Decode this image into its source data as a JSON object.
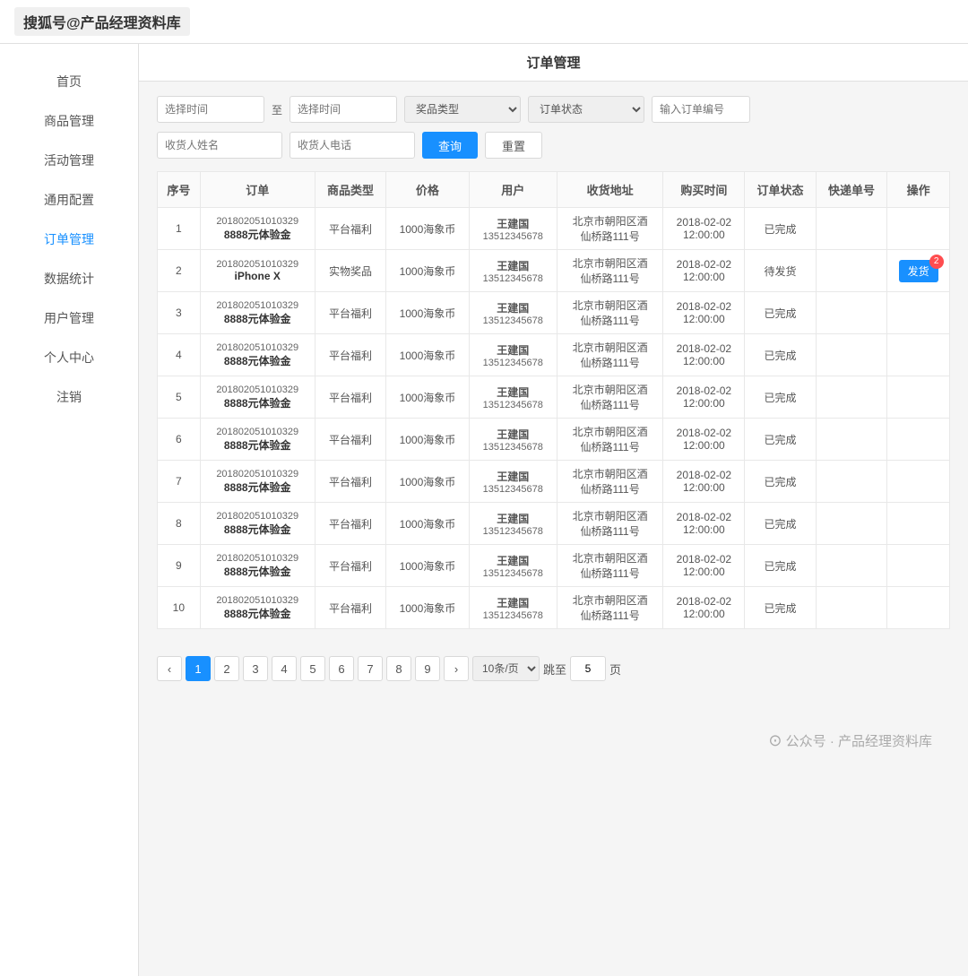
{
  "header": {
    "logo": "搜狐号@产品经理资料库"
  },
  "page_title": "订单管理",
  "sidebar": {
    "items": [
      {
        "label": "首页",
        "active": false
      },
      {
        "label": "商品管理",
        "active": false
      },
      {
        "label": "活动管理",
        "active": false
      },
      {
        "label": "通用配置",
        "active": false
      },
      {
        "label": "订单管理",
        "active": true
      },
      {
        "label": "数据统计",
        "active": false
      },
      {
        "label": "用户管理",
        "active": false
      },
      {
        "label": "个人中心",
        "active": false
      },
      {
        "label": "注销",
        "active": false
      }
    ]
  },
  "filters": {
    "date_from_placeholder": "选择时间",
    "date_to_placeholder": "选择时间",
    "prize_type_placeholder": "奖品类型",
    "order_status_placeholder": "订单状态",
    "order_no_placeholder": "输入订单编号",
    "receiver_name_placeholder": "收货人姓名",
    "receiver_phone_placeholder": "收货人电话",
    "query_btn": "查询",
    "reset_btn": "重置"
  },
  "table": {
    "columns": [
      "序号",
      "订单",
      "商品类型",
      "价格",
      "用户",
      "收货地址",
      "购买时间",
      "订单状态",
      "快递单号",
      "操作"
    ],
    "rows": [
      {
        "index": "1",
        "order_no": "201802051010329",
        "order_name": "8888元体验金",
        "product_type": "平台福利",
        "price": "1000海象币",
        "user_name": "王建国",
        "user_phone": "13512345678",
        "address": "北京市朝阳区酒仙桥路111号",
        "buy_time": "2018-02-02 12:00:00",
        "status": "已完成",
        "express_no": "",
        "action": "",
        "has_ship_btn": false
      },
      {
        "index": "2",
        "order_no": "201802051010329",
        "order_name": "iPhone X",
        "product_type": "实物奖品",
        "price": "1000海象币",
        "user_name": "王建国",
        "user_phone": "13512345678",
        "address": "北京市朝阳区酒仙桥路111号",
        "buy_time": "2018-02-02 12:00:00",
        "status": "待发货",
        "express_no": "",
        "action": "发货",
        "has_ship_btn": true,
        "badge": "2"
      },
      {
        "index": "3",
        "order_no": "201802051010329",
        "order_name": "8888元体验金",
        "product_type": "平台福利",
        "price": "1000海象币",
        "user_name": "王建国",
        "user_phone": "13512345678",
        "address": "北京市朝阳区酒仙桥路111号",
        "buy_time": "2018-02-02 12:00:00",
        "status": "已完成",
        "express_no": "",
        "action": "",
        "has_ship_btn": false
      },
      {
        "index": "4",
        "order_no": "201802051010329",
        "order_name": "8888元体验金",
        "product_type": "平台福利",
        "price": "1000海象币",
        "user_name": "王建国",
        "user_phone": "13512345678",
        "address": "北京市朝阳区酒仙桥路111号",
        "buy_time": "2018-02-02 12:00:00",
        "status": "已完成",
        "express_no": "",
        "action": "",
        "has_ship_btn": false
      },
      {
        "index": "5",
        "order_no": "201802051010329",
        "order_name": "8888元体验金",
        "product_type": "平台福利",
        "price": "1000海象币",
        "user_name": "王建国",
        "user_phone": "13512345678",
        "address": "北京市朝阳区酒仙桥路111号",
        "buy_time": "2018-02-02 12:00:00",
        "status": "已完成",
        "express_no": "",
        "action": "",
        "has_ship_btn": false
      },
      {
        "index": "6",
        "order_no": "201802051010329",
        "order_name": "8888元体验金",
        "product_type": "平台福利",
        "price": "1000海象币",
        "user_name": "王建国",
        "user_phone": "13512345678",
        "address": "北京市朝阳区酒仙桥路111号",
        "buy_time": "2018-02-02 12:00:00",
        "status": "已完成",
        "express_no": "",
        "action": "",
        "has_ship_btn": false
      },
      {
        "index": "7",
        "order_no": "201802051010329",
        "order_name": "8888元体验金",
        "product_type": "平台福利",
        "price": "1000海象币",
        "user_name": "王建国",
        "user_phone": "13512345678",
        "address": "北京市朝阳区酒仙桥路111号",
        "buy_time": "2018-02-02 12:00:00",
        "status": "已完成",
        "express_no": "",
        "action": "",
        "has_ship_btn": false
      },
      {
        "index": "8",
        "order_no": "201802051010329",
        "order_name": "8888元体验金",
        "product_type": "平台福利",
        "price": "1000海象币",
        "user_name": "王建国",
        "user_phone": "13512345678",
        "address": "北京市朝阳区酒仙桥路111号",
        "buy_time": "2018-02-02 12:00:00",
        "status": "已完成",
        "express_no": "",
        "action": "",
        "has_ship_btn": false
      },
      {
        "index": "9",
        "order_no": "201802051010329",
        "order_name": "8888元体验金",
        "product_type": "平台福利",
        "price": "1000海象币",
        "user_name": "王建国",
        "user_phone": "13512345678",
        "address": "北京市朝阳区酒仙桥路111号",
        "buy_time": "2018-02-02 12:00:00",
        "status": "已完成",
        "express_no": "",
        "action": "",
        "has_ship_btn": false
      },
      {
        "index": "10",
        "order_no": "201802051010329",
        "order_name": "8888元体验金",
        "product_type": "平台福利",
        "price": "1000海象币",
        "user_name": "王建国",
        "user_phone": "13512345678",
        "address": "北京市朝阳区酒仙桥路111号",
        "buy_time": "2018-02-02 12:00:00",
        "status": "已完成",
        "express_no": "",
        "action": "",
        "has_ship_btn": false
      }
    ]
  },
  "pagination": {
    "prev": "‹",
    "next": "›",
    "pages": [
      "1",
      "2",
      "3",
      "4",
      "5",
      "6",
      "7",
      "8",
      "9"
    ],
    "active_page": "1",
    "page_size_label": "10条/页",
    "jump_label": "跳至",
    "jump_value": "5",
    "page_suffix": "页"
  },
  "watermark": "公众号 · 产品经理资料库"
}
